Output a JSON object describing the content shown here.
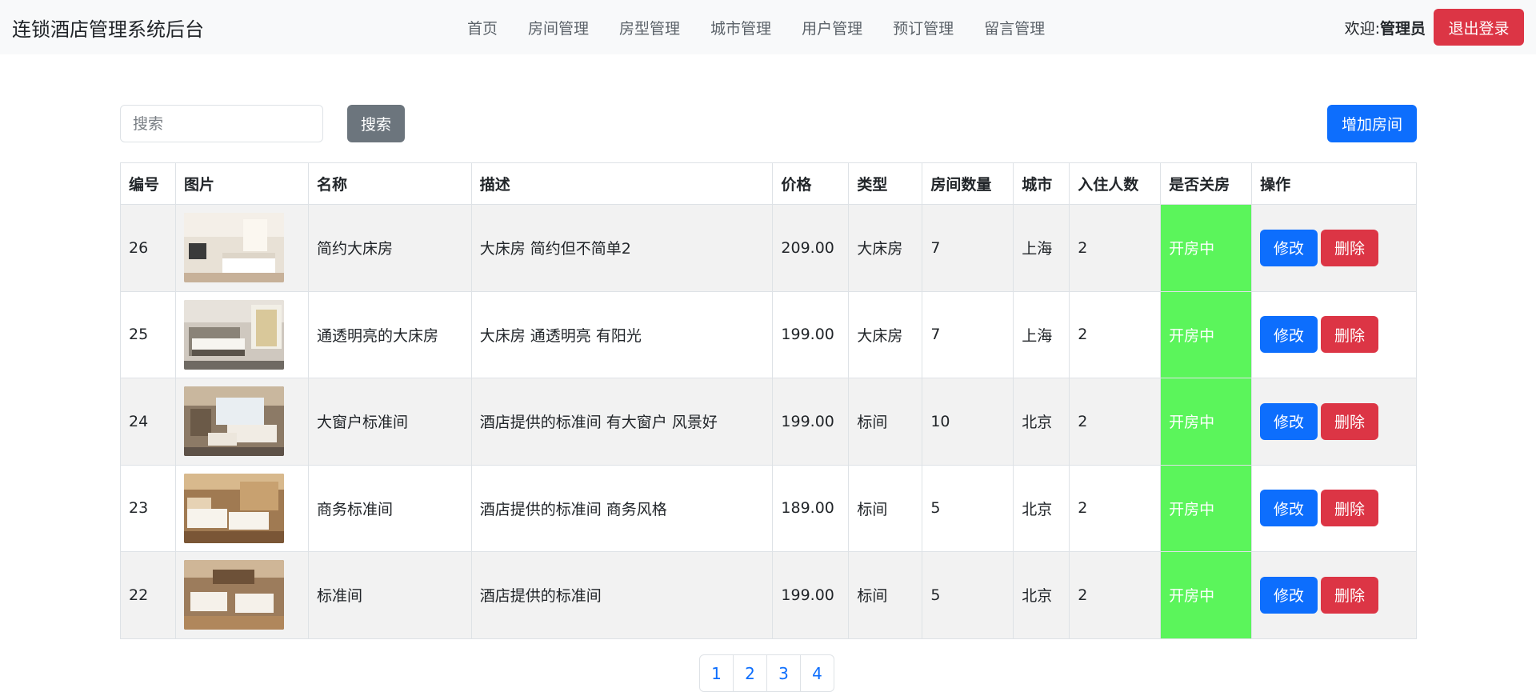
{
  "app": {
    "title": "连锁酒店管理系统后台"
  },
  "nav": {
    "links": [
      {
        "label": "首页"
      },
      {
        "label": "房间管理"
      },
      {
        "label": "房型管理"
      },
      {
        "label": "城市管理"
      },
      {
        "label": "用户管理"
      },
      {
        "label": "预订管理"
      },
      {
        "label": "留言管理"
      }
    ],
    "welcome_prefix": "欢迎:",
    "user_name": "管理员",
    "logout_label": "退出登录"
  },
  "toolbar": {
    "search_placeholder": "搜索",
    "search_value": "",
    "search_button": "搜索",
    "add_button": "增加房间"
  },
  "table": {
    "headers": [
      "编号",
      "图片",
      "名称",
      "描述",
      "价格",
      "类型",
      "房间数量",
      "城市",
      "入住人数",
      "是否关房",
      "操作"
    ],
    "edit_label": "修改",
    "delete_label": "删除",
    "status_color": "#5bf55b",
    "rows": [
      {
        "id": "26",
        "image": "room-photo",
        "name": "简约大床房",
        "desc": "大床房 简约但不简单2",
        "price": "209.00",
        "type": "大床房",
        "count": "7",
        "city": "上海",
        "guests": "2",
        "status": "开房中"
      },
      {
        "id": "25",
        "image": "room-photo",
        "name": "通透明亮的大床房",
        "desc": "大床房 通透明亮 有阳光",
        "price": "199.00",
        "type": "大床房",
        "count": "7",
        "city": "上海",
        "guests": "2",
        "status": "开房中"
      },
      {
        "id": "24",
        "image": "room-photo",
        "name": "大窗户标准间",
        "desc": "酒店提供的标准间 有大窗户 风景好",
        "price": "199.00",
        "type": "标间",
        "count": "10",
        "city": "北京",
        "guests": "2",
        "status": "开房中"
      },
      {
        "id": "23",
        "image": "room-photo",
        "name": "商务标准间",
        "desc": "酒店提供的标准间 商务风格",
        "price": "189.00",
        "type": "标间",
        "count": "5",
        "city": "北京",
        "guests": "2",
        "status": "开房中"
      },
      {
        "id": "22",
        "image": "room-photo",
        "name": "标准间",
        "desc": "酒店提供的标准间",
        "price": "199.00",
        "type": "标间",
        "count": "5",
        "city": "北京",
        "guests": "2",
        "status": "开房中"
      }
    ]
  },
  "pagination": {
    "pages": [
      "1",
      "2",
      "3",
      "4"
    ]
  },
  "colors": {
    "primary": "#0d6efd",
    "danger": "#dc3545",
    "secondary": "#6c757d",
    "status_open": "#5bf55b"
  }
}
